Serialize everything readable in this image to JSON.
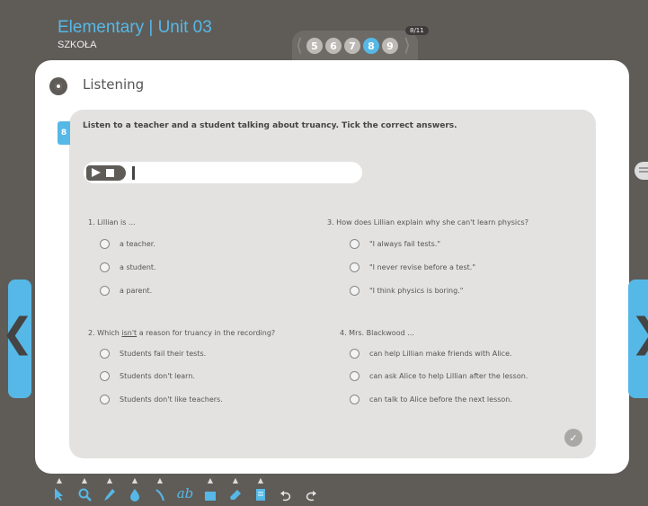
{
  "header": {
    "title": "Elementary | Unit 03",
    "subtitle": "SZKOŁA"
  },
  "pager": {
    "pages": [
      "5",
      "6",
      "7",
      "8",
      "9"
    ],
    "active_page": "8",
    "count": "8/11"
  },
  "section": {
    "title": "Listening",
    "icon": "record-icon"
  },
  "exercise": {
    "number": "8",
    "instruction": "Listen to a teacher and a student talking about truancy. Tick the correct answers.",
    "questions": [
      {
        "text": "1. Lillian is ...",
        "options": [
          "a teacher.",
          "a student.",
          "a parent."
        ]
      },
      {
        "text": "2. Which isn't a reason for truancy in the recording?",
        "text_pre": "2. Which ",
        "text_underlined": "isn't",
        "text_post": " a reason for truancy in the recording?",
        "options": [
          "Students fail their tests.",
          "Students don't learn.",
          "Students don't like teachers."
        ]
      },
      {
        "text": "3. How does Lillian explain why she can't learn physics?",
        "options": [
          "\"I always fail tests.\"",
          "\"I never revise before a test.\"",
          "\"I think physics is boring.\""
        ]
      },
      {
        "text": "4. Mrs. Blackwood ...",
        "options": [
          "can help Lillian make friends with Alice.",
          "can ask Alice to help Lillian after the lesson.",
          "can talk to Alice before the next lesson."
        ]
      }
    ],
    "check_label": "✓"
  },
  "nav": {
    "prev": "❮",
    "next": "❯"
  },
  "toolbar": {
    "tools": [
      "pointer-icon",
      "zoom-icon",
      "pencil-icon",
      "fill-icon",
      "line-icon",
      "text-tool-icon",
      "rectangle-icon",
      "eraser-icon",
      "page-icon",
      "undo-icon",
      "redo-icon"
    ],
    "text_tool_label": "ab"
  },
  "colors": {
    "accent": "#56b8e6",
    "background": "#5f5c58",
    "panel": "#e3e2e0"
  }
}
